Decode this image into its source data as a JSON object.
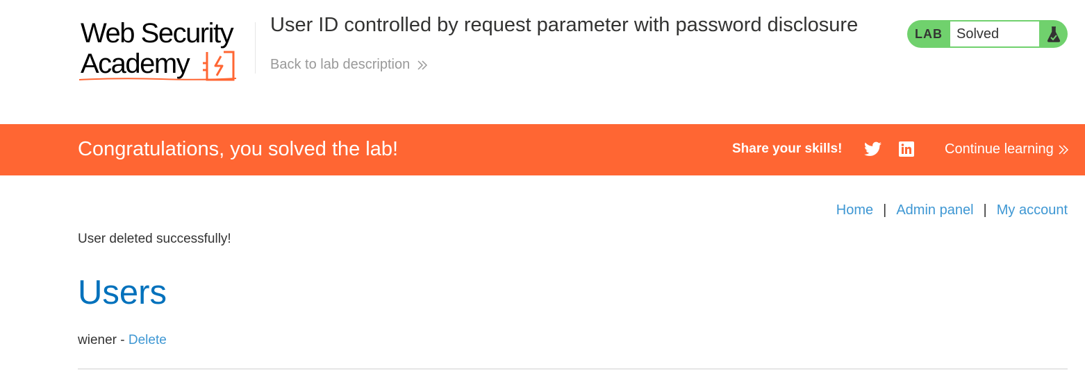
{
  "header": {
    "logo_line1": "Web Security",
    "logo_line2": "Academy",
    "lab_title": "User ID controlled by request parameter with password disclosure",
    "back_link": "Back to lab description",
    "lab_status": {
      "label": "LAB",
      "status": "Solved",
      "color": "#70d16d"
    }
  },
  "banner": {
    "title": "Congratulations, you solved the lab!",
    "share_label": "Share your skills!",
    "continue_label": "Continue learning",
    "color": "#ff6633",
    "icons": [
      "twitter-icon",
      "linkedin-icon"
    ]
  },
  "nav": {
    "items": [
      {
        "label": "Home"
      },
      {
        "label": "Admin panel"
      },
      {
        "label": "My account"
      }
    ],
    "separator": "|"
  },
  "main": {
    "message": "User deleted successfully!",
    "heading": "Users",
    "users": [
      {
        "name": "wiener",
        "separator": " - ",
        "action": "Delete"
      }
    ]
  }
}
